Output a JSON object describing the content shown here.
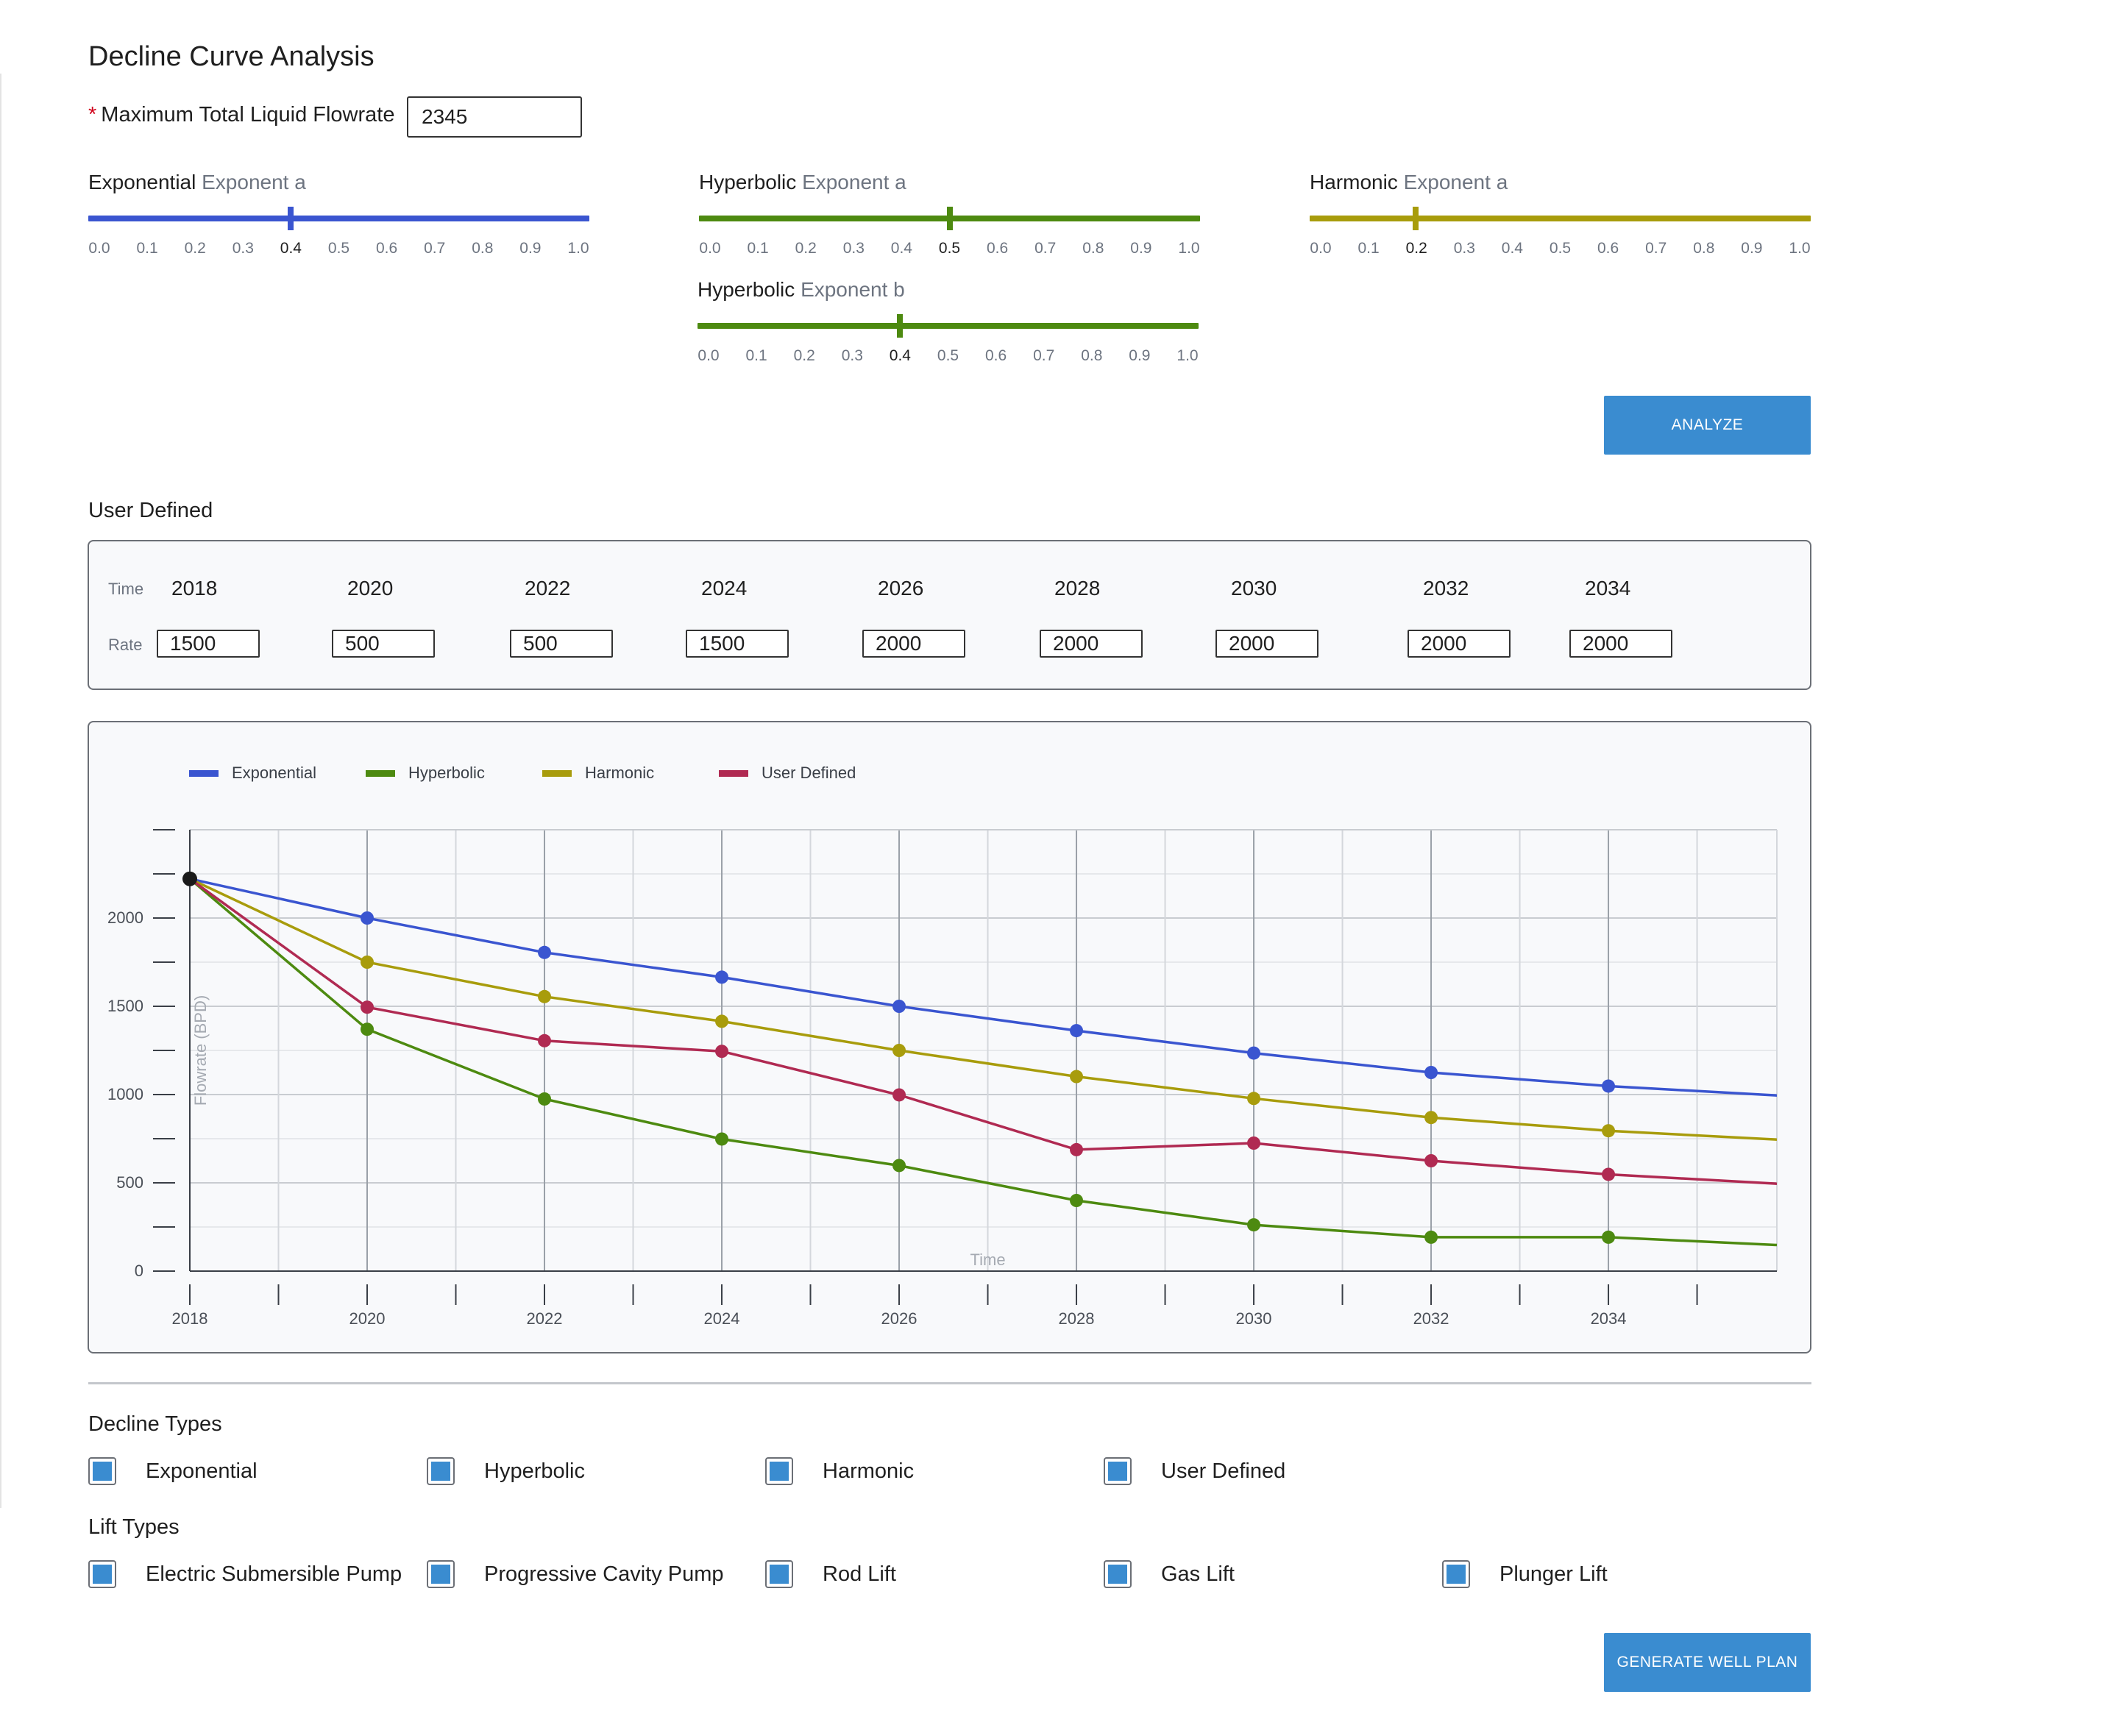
{
  "page": {
    "title": "Decline Curve Analysis"
  },
  "flowrate": {
    "required_mark": "*",
    "label": "Maximum Total Liquid Flowrate",
    "value": "2345"
  },
  "sliders": [
    {
      "id": "exp-a",
      "name": "Exponential",
      "param": "Exponent a",
      "color": "#3a55d0",
      "value": 0.4
    },
    {
      "id": "hyp-a",
      "name": "Hyperbolic",
      "param": "Exponent a",
      "color": "#4d8a10",
      "value": 0.5
    },
    {
      "id": "har-a",
      "name": "Harmonic",
      "param": "Exponent a",
      "color": "#a89c0c",
      "value": 0.2
    },
    {
      "id": "hyp-b",
      "name": "Hyperbolic",
      "param": "Exponent b",
      "color": "#4d8a10",
      "value": 0.4
    }
  ],
  "slider_ticks": [
    "0.0",
    "0.1",
    "0.2",
    "0.3",
    "0.4",
    "0.5",
    "0.6",
    "0.7",
    "0.8",
    "0.9",
    "1.0"
  ],
  "analyze_button": "ANALYZE",
  "user_defined": {
    "heading": "User Defined",
    "time_label": "Time",
    "rate_label": "Rate",
    "years": [
      "2018",
      "2020",
      "2022",
      "2024",
      "2026",
      "2028",
      "2030",
      "2032",
      "2034"
    ],
    "rates": [
      "1500",
      "500",
      "500",
      "1500",
      "2000",
      "2000",
      "2000",
      "2000",
      "2000"
    ]
  },
  "chart_data": {
    "type": "line",
    "title": "",
    "xlabel": "Time",
    "ylabel": "Flowrate (BPD)",
    "x_tick_labels": [
      "2018",
      "2020",
      "2022",
      "2024",
      "2026",
      "2028",
      "2030",
      "2032",
      "2034"
    ],
    "y_tick_labels": [
      "0",
      "500",
      "1000",
      "1500",
      "2000"
    ],
    "xlim": [
      2018,
      2035.9
    ],
    "ylim": [
      0,
      2500
    ],
    "grid": true,
    "legend_position": "top-left",
    "start_point": {
      "x": 2018,
      "y": 2222,
      "color": "#1a1a1a"
    },
    "series": [
      {
        "name": "Exponential",
        "color": "#3a55d0",
        "x": [
          2020,
          2022,
          2024,
          2026,
          2028,
          2030,
          2032,
          2034
        ],
        "y": [
          2000,
          1805,
          1665,
          1500,
          1362,
          1235,
          1125,
          1048
        ],
        "end": 995
      },
      {
        "name": "Hyperbolic",
        "color": "#4d8a10",
        "x": [
          2020,
          2022,
          2024,
          2026,
          2028,
          2030,
          2032,
          2034
        ],
        "y": [
          1370,
          975,
          748,
          598,
          400,
          262,
          192,
          192
        ],
        "end": 148
      },
      {
        "name": "Harmonic",
        "color": "#a89c0c",
        "x": [
          2020,
          2022,
          2024,
          2026,
          2028,
          2030,
          2032,
          2034
        ],
        "y": [
          1750,
          1555,
          1415,
          1250,
          1102,
          978,
          870,
          795
        ],
        "end": 745
      },
      {
        "name": "User Defined",
        "color": "#b02a52",
        "x": [
          2020,
          2022,
          2024,
          2026,
          2028,
          2030,
          2032,
          2034
        ],
        "y": [
          1495,
          1305,
          1245,
          998,
          688,
          725,
          625,
          548
        ],
        "end": 495
      }
    ]
  },
  "decline_types": {
    "heading": "Decline Types",
    "items": [
      "Exponential",
      "Hyperbolic",
      "Harmonic",
      "User Defined"
    ],
    "checked": [
      true,
      true,
      true,
      true
    ]
  },
  "lift_types": {
    "heading": "Lift Types",
    "items": [
      "Electric Submersible Pump",
      "Progressive Cavity Pump",
      "Rod Lift",
      "Gas Lift",
      "Plunger Lift"
    ],
    "checked": [
      true,
      true,
      true,
      true,
      true
    ]
  },
  "generate_button": "GENERATE WELL PLAN",
  "colors": {
    "accent": "#3a8cd0",
    "required": "#d0021b"
  }
}
